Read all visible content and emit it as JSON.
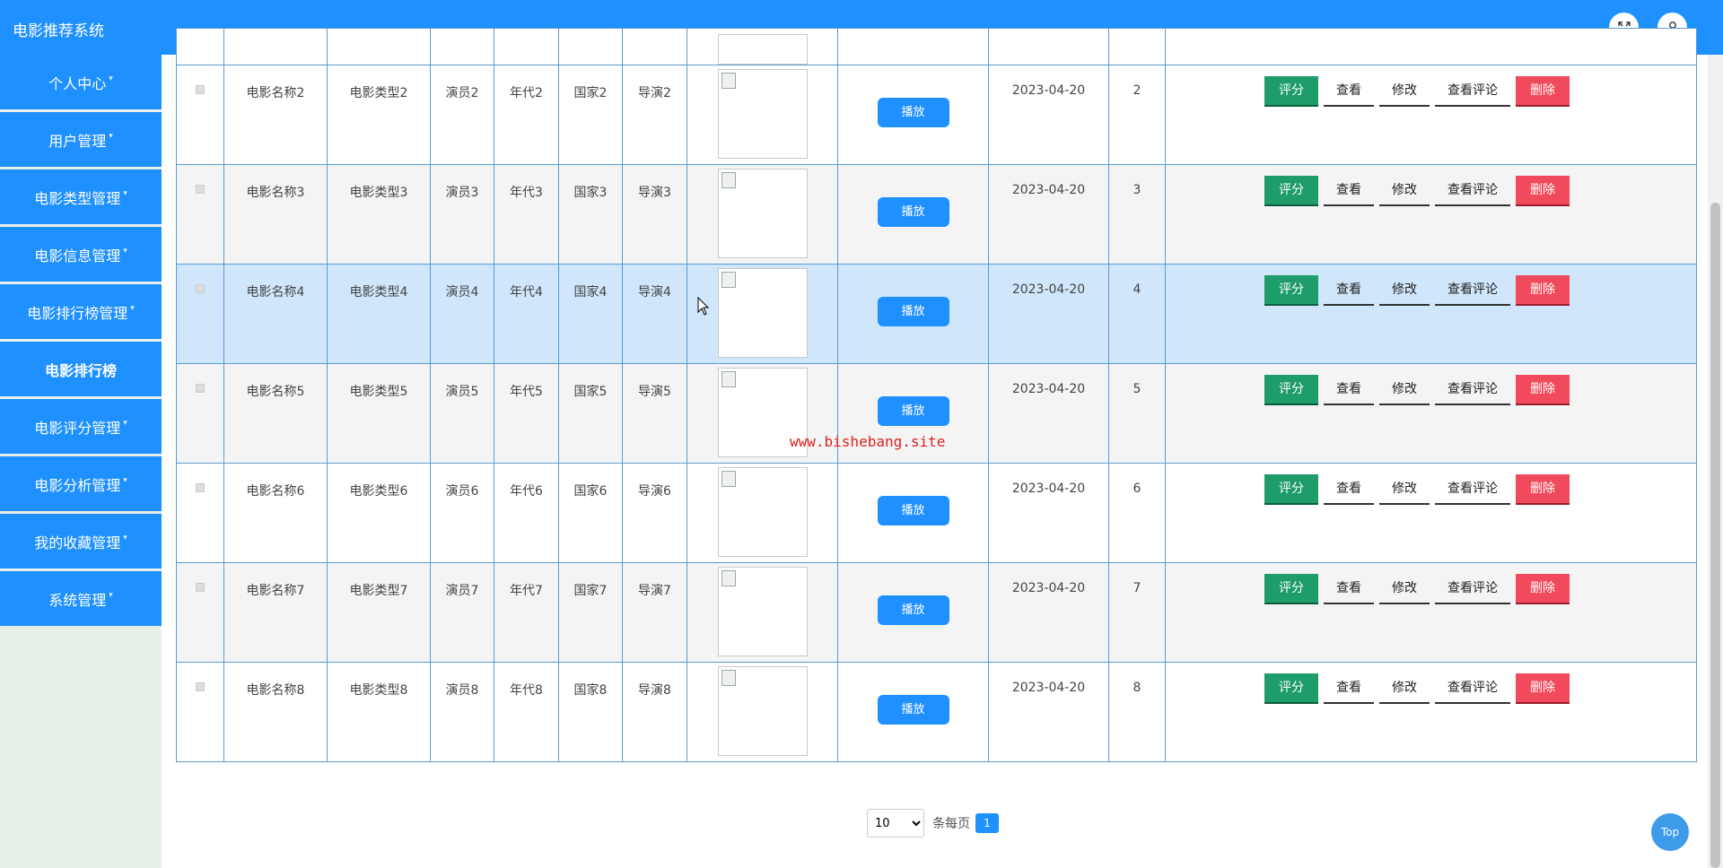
{
  "app": {
    "title": "电影推荐系统"
  },
  "header_icons": [
    "fullscreen-icon",
    "user-icon"
  ],
  "sidebar": {
    "items": [
      {
        "label": "个人中心",
        "caret": true,
        "bold": false
      },
      {
        "label": "用户管理",
        "caret": true,
        "bold": false
      },
      {
        "label": "电影类型管理",
        "caret": true,
        "bold": false
      },
      {
        "label": "电影信息管理",
        "caret": true,
        "bold": false
      },
      {
        "label": "电影排行榜管理",
        "caret": true,
        "bold": false
      },
      {
        "label": "电影排行榜",
        "caret": false,
        "bold": true
      },
      {
        "label": "电影评分管理",
        "caret": true,
        "bold": false
      },
      {
        "label": "电影分析管理",
        "caret": true,
        "bold": false
      },
      {
        "label": "我的收藏管理",
        "caret": true,
        "bold": false
      },
      {
        "label": "系统管理",
        "caret": true,
        "bold": false
      }
    ]
  },
  "table": {
    "play_label": "播放",
    "actions": {
      "rate": "评分",
      "view": "查看",
      "edit": "修改",
      "comments": "查看评论",
      "delete": "删除"
    },
    "rows": [
      {
        "name": "电影名称2",
        "type": "电影类型2",
        "actor": "演员2",
        "year": "年代2",
        "country": "国家2",
        "director": "导演2",
        "date": "2023-04-20",
        "rank": "2"
      },
      {
        "name": "电影名称3",
        "type": "电影类型3",
        "actor": "演员3",
        "year": "年代3",
        "country": "国家3",
        "director": "导演3",
        "date": "2023-04-20",
        "rank": "3"
      },
      {
        "name": "电影名称4",
        "type": "电影类型4",
        "actor": "演员4",
        "year": "年代4",
        "country": "国家4",
        "director": "导演4",
        "date": "2023-04-20",
        "rank": "4"
      },
      {
        "name": "电影名称5",
        "type": "电影类型5",
        "actor": "演员5",
        "year": "年代5",
        "country": "国家5",
        "director": "导演5",
        "date": "2023-04-20",
        "rank": "5"
      },
      {
        "name": "电影名称6",
        "type": "电影类型6",
        "actor": "演员6",
        "year": "年代6",
        "country": "国家6",
        "director": "导演6",
        "date": "2023-04-20",
        "rank": "6"
      },
      {
        "name": "电影名称7",
        "type": "电影类型7",
        "actor": "演员7",
        "year": "年代7",
        "country": "国家7",
        "director": "导演7",
        "date": "2023-04-20",
        "rank": "7"
      },
      {
        "name": "电影名称8",
        "type": "电影类型8",
        "actor": "演员8",
        "year": "年代8",
        "country": "国家8",
        "director": "导演8",
        "date": "2023-04-20",
        "rank": "8"
      }
    ],
    "highlighted_row": 2
  },
  "pagination": {
    "page_size": "10",
    "page_size_options": [
      "10"
    ],
    "per_page_label": "条每页",
    "current_page": "1"
  },
  "watermark": "www.bishebang.site",
  "top_button": "Top",
  "colors": {
    "primary": "#1e90ff",
    "rate": "#1e9c6a",
    "delete": "#f04a5c",
    "row_highlight": "#cfe6fb"
  }
}
